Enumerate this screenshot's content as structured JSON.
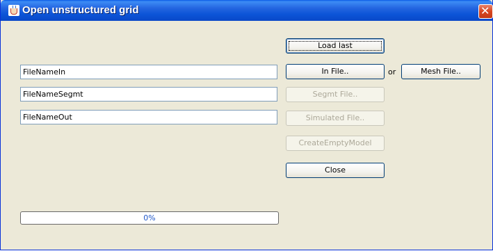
{
  "window": {
    "title": "Open unstructured grid",
    "close_glyph": "✕"
  },
  "fields": {
    "file_name_in": "FileNameIn",
    "file_name_segmt": "FileNameSegmt",
    "file_name_out": "FileNameOut"
  },
  "buttons": {
    "load_last": "Load last",
    "in_file": "In File..",
    "or_label": "or",
    "mesh_file": "Mesh File..",
    "segmt_file": "Segmt File..",
    "simulated_file": "Simulated File..",
    "create_empty_model": "CreateEmptyModel",
    "close": "Close"
  },
  "progress": {
    "label": "0%",
    "value": 0
  },
  "icons": {
    "title_icon": "java-coffee-cup-icon",
    "close_icon": "close-icon"
  }
}
